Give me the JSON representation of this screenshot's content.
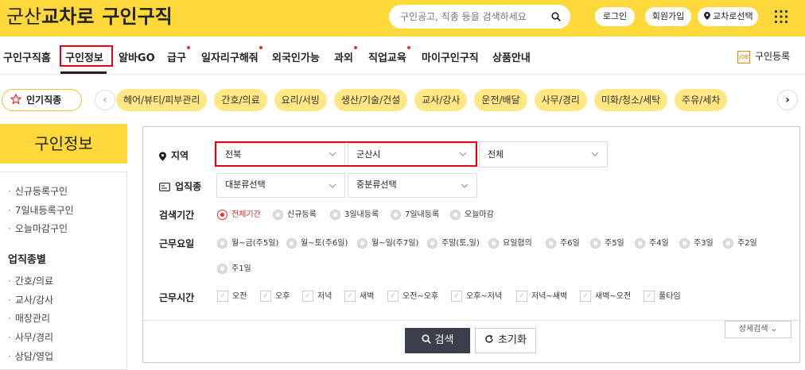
{
  "header": {
    "logo_part1": "군산",
    "logo_part2": "교차로",
    "logo_part3": "구인구직",
    "search_placeholder": "구인공고, 직종 등을 검색하세요",
    "login": "로그인",
    "signup": "회원가입",
    "region_select": "교차로선택"
  },
  "nav": {
    "items": [
      "구인구직홈",
      "구인정보",
      "알바GO",
      "급구",
      "일자리구해줘",
      "외국인가능",
      "과외",
      "직업교육",
      "마이구인구직",
      "상품안내"
    ],
    "active": "구인정보",
    "register": "구인등록",
    "register_icon_text": "JOB"
  },
  "popular": {
    "label": "인기직종",
    "chips": [
      "헤어/뷰티/피부관리",
      "간호/의료",
      "요리/서빙",
      "생산/기술/건설",
      "교사/강사",
      "운전/배달",
      "사무/경리",
      "미화/청소/세탁",
      "주유/세차"
    ]
  },
  "sidebar": {
    "title": "구인정보",
    "links": [
      "신규등록구인",
      "7일내등록구인",
      "오늘마감구인"
    ],
    "category_title": "업직종별",
    "categories": [
      "간호/의료",
      "교사/강사",
      "매장관리",
      "사무/경리",
      "상담/영업"
    ]
  },
  "filters": {
    "region_label": "지역",
    "region_values": [
      "전북",
      "군산시",
      "전체"
    ],
    "job_label": "업직종",
    "job_values": [
      "대분류선택",
      "중분류선택"
    ],
    "period_label": "검색기간",
    "period_options": [
      "전체기간",
      "신규등록",
      "3일내등록",
      "7일내등록",
      "오늘마감"
    ],
    "period_selected": "전체기간",
    "workdays_label": "근무요일",
    "workdays_options": [
      "월~금(주5일)",
      "월~토(주6일)",
      "월~일(주7일)",
      "주말(토,일)",
      "요일협의",
      "주6일",
      "주5일",
      "주4일",
      "주3일",
      "주2일",
      "주1일"
    ],
    "worktime_label": "근무시간",
    "worktime_options": [
      "오전",
      "오후",
      "저녁",
      "새벽",
      "오전~오후",
      "오후~저녁",
      "저녁~새벽",
      "새벽~오전",
      "풀타임"
    ]
  },
  "actions": {
    "search": "검색",
    "reset": "초기화",
    "detail": "상세검색 ⌄"
  },
  "colors": {
    "brand_yellow": "#ffd83c",
    "chip_yellow": "#ffe783",
    "highlight_red": "#e5001c",
    "button_dark": "#3a3f4b"
  }
}
